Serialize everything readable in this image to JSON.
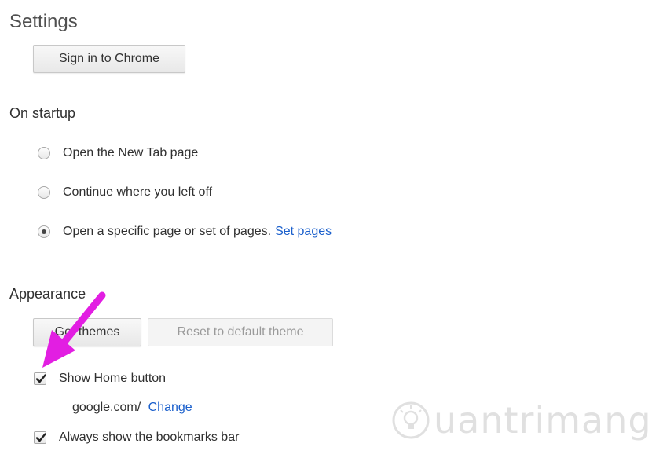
{
  "header": {
    "title": "Settings"
  },
  "sign_in": {
    "button_label": "Sign in to Chrome"
  },
  "startup": {
    "heading": "On startup",
    "options": [
      {
        "label": "Open the New Tab page",
        "selected": false
      },
      {
        "label": "Continue where you left off",
        "selected": false
      },
      {
        "label": "Open a specific page or set of pages.",
        "selected": true,
        "link": "Set pages"
      }
    ]
  },
  "appearance": {
    "heading": "Appearance",
    "get_themes_label": "Get themes",
    "reset_theme_label": "Reset to default theme",
    "show_home_button": {
      "label": "Show Home button",
      "checked": true
    },
    "home_url": "google.com/",
    "home_change_link": "Change",
    "bookmarks_bar": {
      "label": "Always show the bookmarks bar",
      "checked": true
    }
  },
  "annotation": {
    "arrow_color": "#e21ee2",
    "arrow_icon": "annotation-arrow"
  },
  "watermark": {
    "text": "uantrimang",
    "icon": "lightbulb-icon"
  },
  "colors": {
    "link": "#1a5fcc",
    "text": "#303030",
    "disabled_text": "#9a9a9a"
  }
}
